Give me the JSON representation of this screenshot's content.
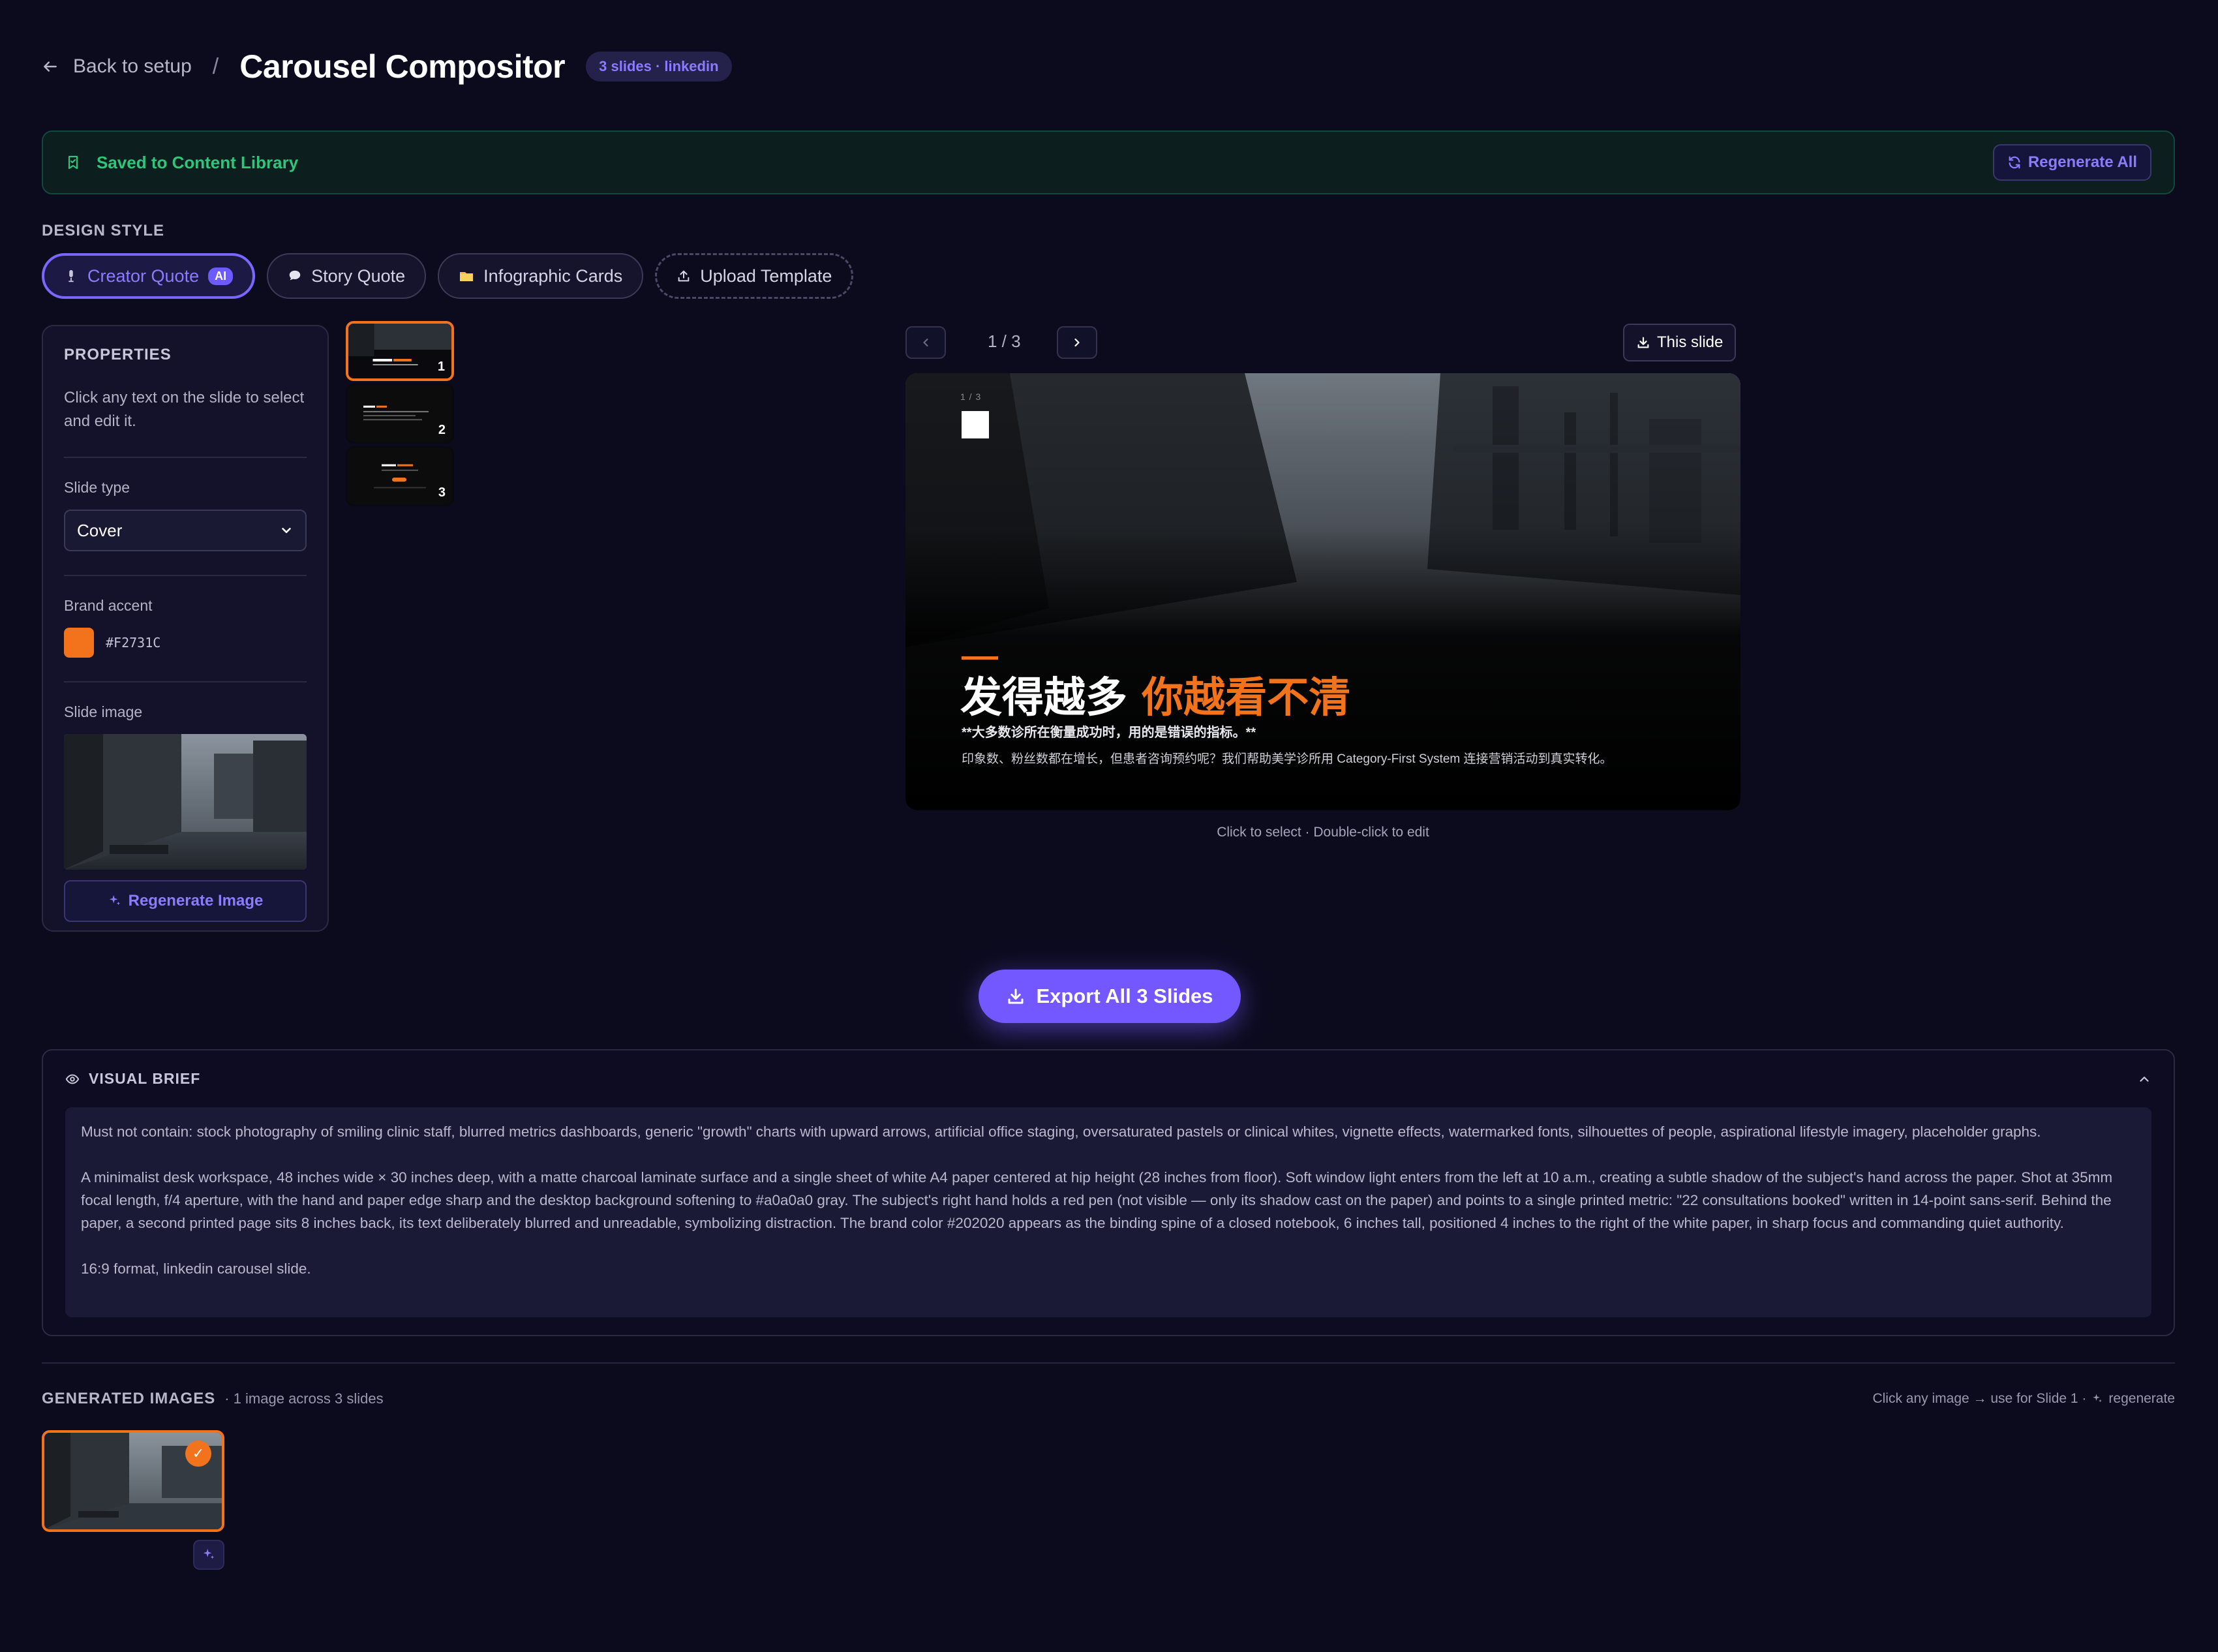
{
  "header": {
    "back_label": "Back to setup",
    "separator": "/",
    "title": "Carousel Compositor",
    "badge": "3 slides · linkedin"
  },
  "banner": {
    "saved_label": "Saved to Content Library",
    "regenerate_all_label": "Regenerate All"
  },
  "design_style": {
    "label": "DESIGN STYLE",
    "options": [
      {
        "label": "Creator Quote",
        "tag": "AI",
        "active": true
      },
      {
        "label": "Story Quote"
      },
      {
        "label": "Infographic Cards"
      },
      {
        "label": "Upload Template"
      }
    ]
  },
  "properties": {
    "title": "PROPERTIES",
    "help": "Click any text on the slide to select and edit it.",
    "slide_type_label": "Slide type",
    "slide_type_value": "Cover",
    "brand_accent_label": "Brand accent",
    "brand_accent_value": "#F2731C",
    "slide_image_label": "Slide image",
    "regenerate_image_label": "Regenerate Image"
  },
  "thumbnails": [
    {
      "number": "1",
      "active": true
    },
    {
      "number": "2"
    },
    {
      "number": "3"
    }
  ],
  "slide_nav": {
    "counter": "1 / 3",
    "this_slide_label": "This slide"
  },
  "slide": {
    "counter_text": "1 / 3",
    "headline_white": "发得越多 ",
    "headline_accent": "你越看不清",
    "subline": "**大多数诊所在衡量成功时，用的是错误的指标。**",
    "body": "印象数、粉丝数都在增长，但患者咨询预约呢？我们帮助美学诊所用 Category-First System 连接营销活动到真实转化。"
  },
  "slide_hint": "Click to select · Double-click to edit",
  "export_label": "Export All 3 Slides",
  "visual_brief": {
    "title": "VISUAL BRIEF",
    "paragraphs": [
      "Must not contain: stock photography of smiling clinic staff, blurred metrics dashboards, generic \"growth\" charts with upward arrows, artificial office staging, oversaturated pastels or clinical whites, vignette effects, watermarked fonts, silhouettes of people, aspirational lifestyle imagery, placeholder graphs.",
      "A minimalist desk workspace, 48 inches wide × 30 inches deep, with a matte charcoal laminate surface and a single sheet of white A4 paper centered at hip height (28 inches from floor). Soft window light enters from the left at 10 a.m., creating a subtle shadow of the subject's hand across the paper. Shot at 35mm focal length, f/4 aperture, with the hand and paper edge sharp and the desktop background softening to #a0a0a0 gray. The subject's right hand holds a red pen (not visible — only its shadow cast on the paper) and points to a single printed metric: \"22 consultations booked\" written in 14-point sans-serif. Behind the paper, a second printed page sits 8 inches back, its text deliberately blurred and unreadable, symbolizing distraction. The brand color #202020 appears as the binding spine of a closed notebook, 6 inches tall, positioned 4 inches to the right of the white paper, in sharp focus and commanding quiet authority.",
      "16:9 format, linkedin carousel slide."
    ]
  },
  "generated_images": {
    "title": "GENERATED IMAGES",
    "count": "· 1 image across 3 slides",
    "hint": "Click any image → use for Slide 1 ·",
    "regenerate_hint": "regenerate"
  },
  "colors": {
    "accent": "#F2731C",
    "primary": "#7357FF",
    "success": "#2FC57A",
    "background": "#0C0B1E"
  }
}
